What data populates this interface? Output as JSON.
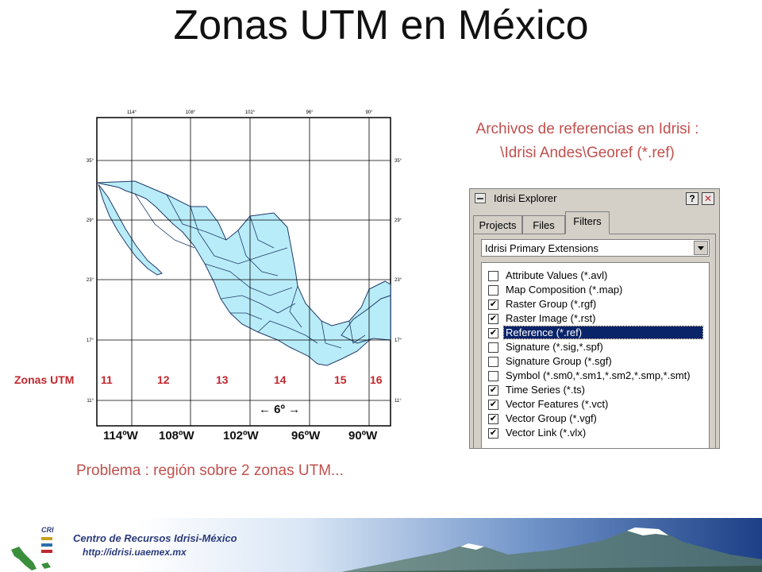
{
  "slide": {
    "title": "Zonas UTM en México",
    "problem": "Problema : región sobre 2 zonas UTM...",
    "archivos_line1": "Archivos de referencias en Idrisi :",
    "archivos_line2": "\\Idrisi Andes\\Georef (*.ref)"
  },
  "map": {
    "top_ticks": [
      "114°",
      "108°",
      "102°",
      "96°",
      "90°"
    ],
    "side_ticks": [
      "35°",
      "29°",
      "23°",
      "17°",
      "11°"
    ],
    "zones_label": "Zonas UTM",
    "zones": [
      "11",
      "12",
      "13",
      "14",
      "15",
      "16"
    ],
    "lon_labels": [
      "114ºW",
      "108ºW",
      "102ºW",
      "96ºW",
      "90ºW"
    ],
    "six_degrees": "6º",
    "colors": {
      "land": "#b9ecf9",
      "frame": "#000000",
      "zone_text": "#c0282e"
    }
  },
  "window": {
    "title": "Idrisi Explorer",
    "help_button": "?",
    "close_button": "✕",
    "tabs": [
      "Projects",
      "Files",
      "Filters"
    ],
    "active_tab": "Filters",
    "dropdown_value": "Idrisi Primary Extensions",
    "items": [
      {
        "label": "Attribute Values (*.avl)",
        "checked": false
      },
      {
        "label": "Map Composition (*.map)",
        "checked": false
      },
      {
        "label": "Raster Group (*.rgf)",
        "checked": true
      },
      {
        "label": "Raster Image (*.rst)",
        "checked": true
      },
      {
        "label": "Reference (*.ref)",
        "checked": true,
        "selected": true
      },
      {
        "label": "Signature (*.sig,*.spf)",
        "checked": false
      },
      {
        "label": "Signature Group (*.sgf)",
        "checked": false
      },
      {
        "label": "Symbol (*.sm0,*.sm1,*.sm2,*.smp,*.smt)",
        "checked": false
      },
      {
        "label": "Time Series (*.ts)",
        "checked": true
      },
      {
        "label": "Vector Features (*.vct)",
        "checked": true
      },
      {
        "label": "Vector Group (*.vgf)",
        "checked": true
      },
      {
        "label": "Vector Link (*.vlx)",
        "checked": true
      }
    ],
    "check_glyph": "✔"
  },
  "footer": {
    "org_name": "Centro de Recursos Idrisi-México",
    "url": "http://idrisi.uaemex.mx",
    "logo_text": "CRI"
  }
}
